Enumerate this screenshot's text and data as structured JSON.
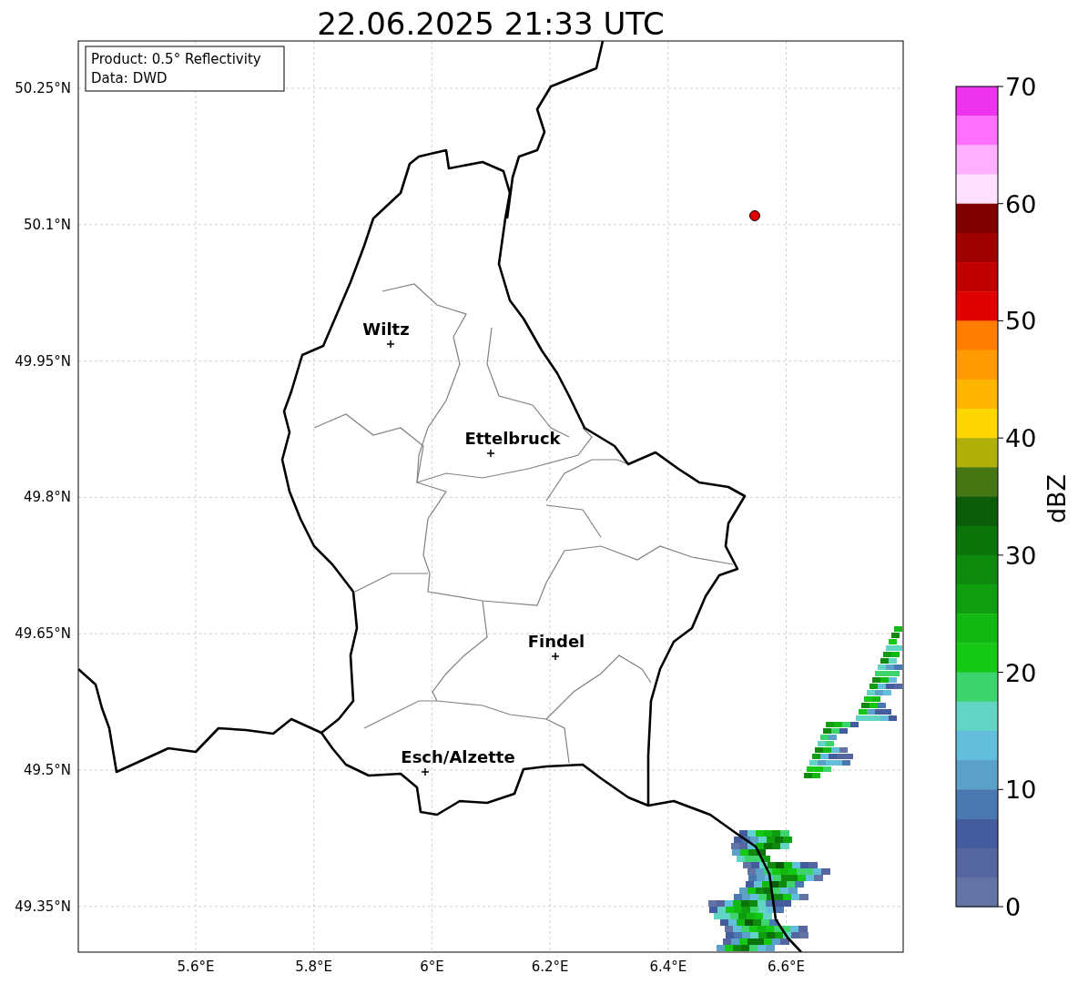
{
  "title": "22.06.2025 21:33 UTC",
  "info_box": {
    "lines": [
      "Product: 0.5° Reflectivity",
      "Data: DWD"
    ]
  },
  "lat_ticks": [
    "50.25°N",
    "50.1°N",
    "49.95°N",
    "49.8°N",
    "49.65°N",
    "49.5°N",
    "49.35°N"
  ],
  "lon_ticks": [
    "5.6°E",
    "5.8°E",
    "6°E",
    "6.2°E",
    "6.4°E",
    "6.6°E"
  ],
  "cities": [
    {
      "name": "Wiltz"
    },
    {
      "name": "Ettelbruck"
    },
    {
      "name": "Findel"
    },
    {
      "name": "Esch/Alzette"
    }
  ],
  "colorbar": {
    "label": "dBZ",
    "ticks": [
      "70",
      "60",
      "50",
      "40",
      "30",
      "20",
      "10",
      "0"
    ],
    "bands": [
      {
        "color": "#ee33ee"
      },
      {
        "color": "#ff70ff"
      },
      {
        "color": "#ffb0ff"
      },
      {
        "color": "#ffe0ff"
      },
      {
        "color": "#7e0000"
      },
      {
        "color": "#a00000"
      },
      {
        "color": "#c00000"
      },
      {
        "color": "#e10000"
      },
      {
        "color": "#ff7d00"
      },
      {
        "color": "#ff9a00"
      },
      {
        "color": "#ffb600"
      },
      {
        "color": "#ffd700"
      },
      {
        "color": "#b0b00a"
      },
      {
        "color": "#467513"
      },
      {
        "color": "#0a5c0a"
      },
      {
        "color": "#0a730a"
      },
      {
        "color": "#0f8a0f"
      },
      {
        "color": "#0f9e0f"
      },
      {
        "color": "#12b812"
      },
      {
        "color": "#14c814"
      },
      {
        "color": "#3dd46e"
      },
      {
        "color": "#62d4c4"
      },
      {
        "color": "#62bedb"
      },
      {
        "color": "#5aa0c8"
      },
      {
        "color": "#4a78b0"
      },
      {
        "color": "#435b9f"
      },
      {
        "color": "#54659f"
      },
      {
        "color": "#6373a3"
      }
    ]
  }
}
